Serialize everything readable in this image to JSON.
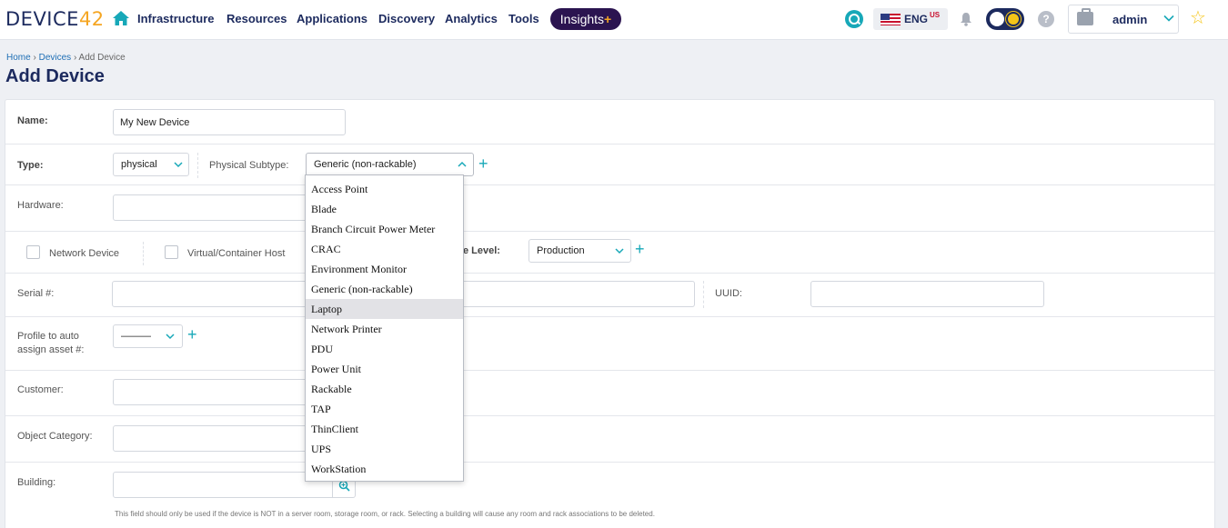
{
  "brand": {
    "logo_prefix": "DEVICE",
    "logo_num": "42"
  },
  "nav": {
    "items": [
      "Infrastructure",
      "Resources",
      "Applications",
      "Discovery",
      "Analytics",
      "Tools"
    ],
    "insights_label": "Insights",
    "insights_plus": "+"
  },
  "header": {
    "lang_code": "ENG",
    "lang_region": "US",
    "help_label": "?",
    "username": "admin",
    "star": "☆"
  },
  "breadcrumb": {
    "home": "Home",
    "devices": "Devices",
    "current": "Add Device",
    "sep": "›"
  },
  "page_title": "Add Device",
  "form": {
    "name_label": "Name:",
    "name_value": "My New Device",
    "type_label": "Type:",
    "type_value": "physical",
    "subtype_label": "Physical Subtype:",
    "subtype_value": "Generic (non-rackable)",
    "hardware_label": "Hardware:",
    "network_device_label": "Network Device",
    "virtual_host_label": "Virtual/Container Host",
    "service_level_label": "e Level:",
    "service_level_value": "Production",
    "serial_label": "Serial #:",
    "uuid_label": "UUID:",
    "profile_label_1": "Profile to auto",
    "profile_label_2": "assign asset #:",
    "profile_value": "———",
    "customer_label": "Customer:",
    "object_category_label": "Object Category:",
    "building_label": "Building:",
    "building_hint": "This field should only be used if the device is NOT in a server room, storage room, or rack. Selecting a building will cause any room and rack associations to be deleted.",
    "plus": "+"
  },
  "subtype_dropdown": {
    "options": [
      "Access Point",
      "Blade",
      "Branch Circuit Power Meter",
      "CRAC",
      "Environment Monitor",
      "Generic (non-rackable)",
      "Laptop",
      "Network Printer",
      "PDU",
      "Power Unit",
      "Rackable",
      "TAP",
      "ThinClient",
      "UPS",
      "WorkStation"
    ],
    "highlighted": "Laptop"
  },
  "colors": {
    "navy": "#1c2a5e",
    "teal": "#17a8b8",
    "orange": "#f5a623",
    "insights_bg": "#2b1450"
  }
}
